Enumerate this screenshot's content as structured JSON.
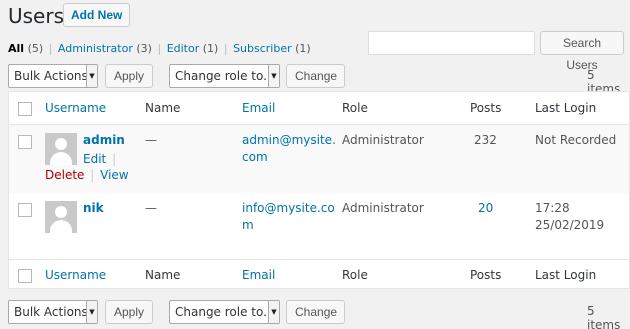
{
  "page": {
    "title": "Users",
    "add_new": "Add New"
  },
  "views": {
    "all": "All",
    "all_count": "(5)",
    "administrator": "Administrator",
    "administrator_count": "(3)",
    "editor": "Editor",
    "editor_count": "(1)",
    "subscriber": "Subscriber",
    "subscriber_count": "(1)",
    "separator": "|"
  },
  "search": {
    "value": "",
    "button": "Search Users"
  },
  "tablenav": {
    "bulk_actions": "Bulk Actions",
    "apply": "Apply",
    "change_role": "Change role to...",
    "change": "Change",
    "items": "5 items"
  },
  "columns": {
    "username": "Username",
    "name": "Name",
    "email": "Email",
    "role": "Role",
    "posts": "Posts",
    "last_login": "Last Login"
  },
  "rows": [
    {
      "username": "admin",
      "name": "—",
      "email_line1": "admin@mysite.",
      "email_line2": "com",
      "role": "Administrator",
      "posts": "232",
      "last_login_line1": "Not Recorded",
      "last_login_line2": "",
      "actions": {
        "edit": "Edit",
        "delete": "Delete",
        "view": "View",
        "sep": "|"
      }
    },
    {
      "username": "nik",
      "name": "—",
      "email_line1": "info@mysite.co",
      "email_line2": "m",
      "role": "Administrator",
      "posts": "20",
      "last_login_line1": "17:28",
      "last_login_line2": "25/02/2019"
    }
  ],
  "annotation": {
    "arrow_color": "#e0202a"
  },
  "colors": {
    "link": "#0073aa",
    "delete": "#aa0000",
    "background": "#f1f1f1"
  }
}
